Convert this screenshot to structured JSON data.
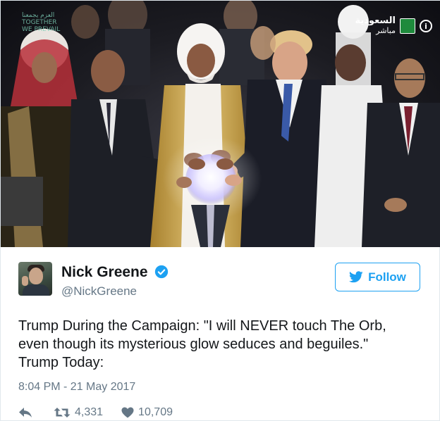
{
  "photo": {
    "channel_name": "السعودية",
    "channel_live": "مباشر",
    "info_icon": "i",
    "watermark_line1": "العزم يجمعنا",
    "watermark_line2": "TOGETHER",
    "watermark_line3": "WE PREVAIL",
    "colors": {
      "orb_glow": "#f3f0ff",
      "thobe_gold": "#c9a24a",
      "suit_dark": "#1d1f26"
    }
  },
  "author": {
    "name": "Nick Greene",
    "handle": "@NickGreene",
    "verified": true,
    "verified_icon": "verified-badge-icon"
  },
  "follow_button": {
    "label": "Follow",
    "icon": "twitter-bird-icon",
    "color": "#1da1f2"
  },
  "tweet": {
    "lines": [
      "Trump During the Campaign: \"I will NEVER touch The Orb,",
      "even though its mysterious glow seduces and beguiles.\"",
      "Trump Today:"
    ],
    "timestamp": "8:04 PM - 21 May 2017"
  },
  "actions": {
    "reply_icon": "reply-icon",
    "retweet_icon": "retweet-icon",
    "retweet_count": "4,331",
    "like_icon": "heart-icon",
    "like_count": "10,709"
  }
}
